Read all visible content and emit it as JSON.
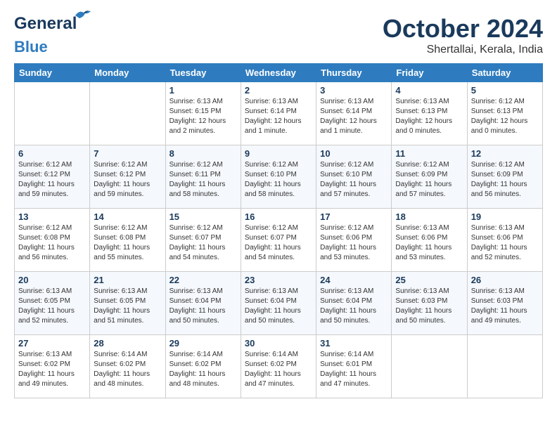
{
  "logo": {
    "general": "General",
    "blue": "Blue"
  },
  "header": {
    "month": "October 2024",
    "location": "Shertallai, Kerala, India"
  },
  "weekdays": [
    "Sunday",
    "Monday",
    "Tuesday",
    "Wednesday",
    "Thursday",
    "Friday",
    "Saturday"
  ],
  "weeks": [
    [
      {
        "day": "",
        "empty": true
      },
      {
        "day": "",
        "empty": true
      },
      {
        "day": "1",
        "sunrise": "6:13 AM",
        "sunset": "6:15 PM",
        "daylight": "12 hours and 2 minutes."
      },
      {
        "day": "2",
        "sunrise": "6:13 AM",
        "sunset": "6:14 PM",
        "daylight": "12 hours and 1 minute."
      },
      {
        "day": "3",
        "sunrise": "6:13 AM",
        "sunset": "6:14 PM",
        "daylight": "12 hours and 1 minute."
      },
      {
        "day": "4",
        "sunrise": "6:13 AM",
        "sunset": "6:13 PM",
        "daylight": "12 hours and 0 minutes."
      },
      {
        "day": "5",
        "sunrise": "6:12 AM",
        "sunset": "6:13 PM",
        "daylight": "12 hours and 0 minutes."
      }
    ],
    [
      {
        "day": "6",
        "sunrise": "6:12 AM",
        "sunset": "6:12 PM",
        "daylight": "11 hours and 59 minutes."
      },
      {
        "day": "7",
        "sunrise": "6:12 AM",
        "sunset": "6:12 PM",
        "daylight": "11 hours and 59 minutes."
      },
      {
        "day": "8",
        "sunrise": "6:12 AM",
        "sunset": "6:11 PM",
        "daylight": "11 hours and 58 minutes."
      },
      {
        "day": "9",
        "sunrise": "6:12 AM",
        "sunset": "6:10 PM",
        "daylight": "11 hours and 58 minutes."
      },
      {
        "day": "10",
        "sunrise": "6:12 AM",
        "sunset": "6:10 PM",
        "daylight": "11 hours and 57 minutes."
      },
      {
        "day": "11",
        "sunrise": "6:12 AM",
        "sunset": "6:09 PM",
        "daylight": "11 hours and 57 minutes."
      },
      {
        "day": "12",
        "sunrise": "6:12 AM",
        "sunset": "6:09 PM",
        "daylight": "11 hours and 56 minutes."
      }
    ],
    [
      {
        "day": "13",
        "sunrise": "6:12 AM",
        "sunset": "6:08 PM",
        "daylight": "11 hours and 56 minutes."
      },
      {
        "day": "14",
        "sunrise": "6:12 AM",
        "sunset": "6:08 PM",
        "daylight": "11 hours and 55 minutes."
      },
      {
        "day": "15",
        "sunrise": "6:12 AM",
        "sunset": "6:07 PM",
        "daylight": "11 hours and 54 minutes."
      },
      {
        "day": "16",
        "sunrise": "6:12 AM",
        "sunset": "6:07 PM",
        "daylight": "11 hours and 54 minutes."
      },
      {
        "day": "17",
        "sunrise": "6:12 AM",
        "sunset": "6:06 PM",
        "daylight": "11 hours and 53 minutes."
      },
      {
        "day": "18",
        "sunrise": "6:13 AM",
        "sunset": "6:06 PM",
        "daylight": "11 hours and 53 minutes."
      },
      {
        "day": "19",
        "sunrise": "6:13 AM",
        "sunset": "6:06 PM",
        "daylight": "11 hours and 52 minutes."
      }
    ],
    [
      {
        "day": "20",
        "sunrise": "6:13 AM",
        "sunset": "6:05 PM",
        "daylight": "11 hours and 52 minutes."
      },
      {
        "day": "21",
        "sunrise": "6:13 AM",
        "sunset": "6:05 PM",
        "daylight": "11 hours and 51 minutes."
      },
      {
        "day": "22",
        "sunrise": "6:13 AM",
        "sunset": "6:04 PM",
        "daylight": "11 hours and 50 minutes."
      },
      {
        "day": "23",
        "sunrise": "6:13 AM",
        "sunset": "6:04 PM",
        "daylight": "11 hours and 50 minutes."
      },
      {
        "day": "24",
        "sunrise": "6:13 AM",
        "sunset": "6:04 PM",
        "daylight": "11 hours and 50 minutes."
      },
      {
        "day": "25",
        "sunrise": "6:13 AM",
        "sunset": "6:03 PM",
        "daylight": "11 hours and 50 minutes."
      },
      {
        "day": "26",
        "sunrise": "6:13 AM",
        "sunset": "6:03 PM",
        "daylight": "11 hours and 49 minutes."
      }
    ],
    [
      {
        "day": "27",
        "sunrise": "6:13 AM",
        "sunset": "6:02 PM",
        "daylight": "11 hours and 49 minutes."
      },
      {
        "day": "28",
        "sunrise": "6:14 AM",
        "sunset": "6:02 PM",
        "daylight": "11 hours and 48 minutes."
      },
      {
        "day": "29",
        "sunrise": "6:14 AM",
        "sunset": "6:02 PM",
        "daylight": "11 hours and 48 minutes."
      },
      {
        "day": "30",
        "sunrise": "6:14 AM",
        "sunset": "6:02 PM",
        "daylight": "11 hours and 47 minutes."
      },
      {
        "day": "31",
        "sunrise": "6:14 AM",
        "sunset": "6:01 PM",
        "daylight": "11 hours and 47 minutes."
      },
      {
        "day": "",
        "empty": true
      },
      {
        "day": "",
        "empty": true
      }
    ]
  ],
  "labels": {
    "sunrise": "Sunrise:",
    "sunset": "Sunset:",
    "daylight": "Daylight hours"
  }
}
